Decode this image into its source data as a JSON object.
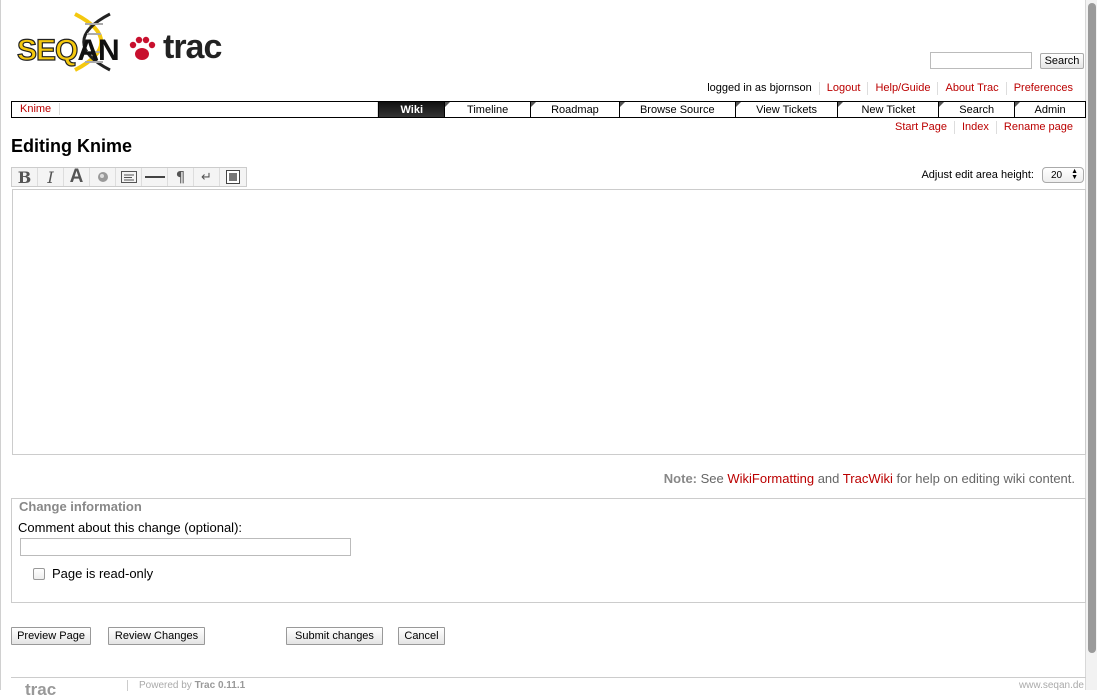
{
  "logo": {
    "seq_text": "SEQ",
    "an_text": "AN",
    "trac_text": "trac"
  },
  "search": {
    "placeholder": "",
    "button": "Search"
  },
  "metanav": [
    "logged in as bjornson",
    "Logout",
    "Help/Guide",
    "About Trac",
    "Preferences"
  ],
  "mainnav": {
    "context": "Knime",
    "tabs": [
      {
        "label": "Wiki",
        "active": true
      },
      {
        "label": "Timeline",
        "active": false
      },
      {
        "label": "Roadmap",
        "active": false
      },
      {
        "label": "Browse Source",
        "active": false
      },
      {
        "label": "View Tickets",
        "active": false
      },
      {
        "label": "New Ticket",
        "active": false
      },
      {
        "label": "Search",
        "active": false
      },
      {
        "label": "Admin",
        "active": false
      }
    ]
  },
  "ctxnav": [
    "Start Page",
    "Index",
    "Rename page"
  ],
  "page": {
    "title": "Editing Knime"
  },
  "toolbar": {
    "icons": [
      "bold-icon",
      "italic-icon",
      "heading-icon",
      "link-icon",
      "code-block-icon",
      "horizontal-rule-icon",
      "paragraph-icon",
      "line-break-icon",
      "image-icon"
    ]
  },
  "adjust": {
    "label": "Adjust edit area height:",
    "value": "20"
  },
  "note": {
    "prefix": "Note:",
    "see": "See",
    "link1": "WikiFormatting",
    "and": "and",
    "link2": "TracWiki",
    "suffix": "for help on editing wiki content."
  },
  "changes": {
    "legend": "Change information",
    "comment_label": "Comment about this change (optional):",
    "comment_value": "",
    "readonly_label": "Page is read-only",
    "readonly_checked": false
  },
  "buttons": {
    "preview": "Preview Page",
    "review": "Review Changes",
    "submit": "Submit changes",
    "cancel": "Cancel"
  },
  "footer": {
    "logo": "trac",
    "powered_prefix": "Powered by",
    "powered_name": "Trac 0.11.1",
    "site": "www.seqan.de"
  },
  "colors": {
    "link": "#bb0000",
    "active_tab": "#222222",
    "logo_yellow": "#f4c80e",
    "paw_red": "#c8102e"
  }
}
